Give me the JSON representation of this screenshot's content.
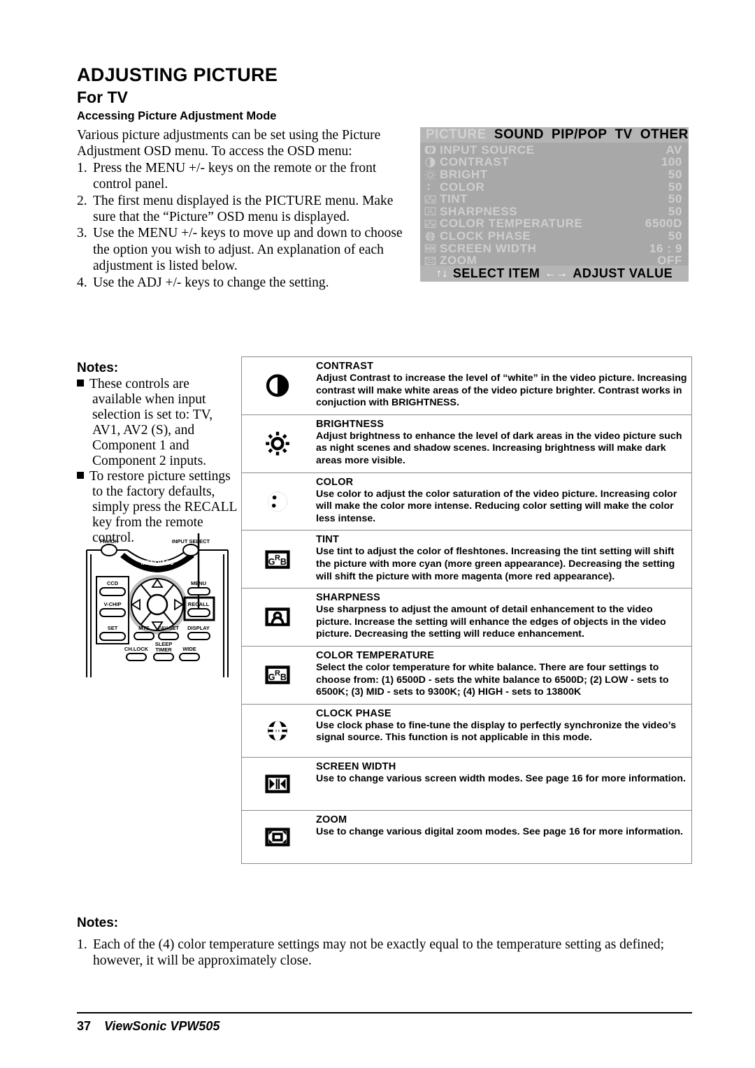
{
  "document": {
    "title_main": "ADJUSTING PICTURE",
    "title_sub": "For TV",
    "section_heading": "Accessing Picture Adjustment Mode"
  },
  "intro": {
    "paragraph": "Various picture adjustments can be set using the Picture Adjustment OSD menu.  To access the OSD menu:",
    "steps": [
      {
        "num": "1.",
        "text": "Press the MENU +/- keys on the remote or the front control panel."
      },
      {
        "num": "2.",
        "text": "The first menu displayed is the PICTURE menu.  Make sure that the “Picture” OSD menu is displayed."
      },
      {
        "num": "3.",
        "text": "Use the MENU +/- keys to move up and down to choose the option you wish to adjust.  An explanation of each adjustment is listed below."
      },
      {
        "num": "4.",
        "text": "Use the ADJ +/- keys to change the setting."
      }
    ]
  },
  "osd": {
    "tabs": [
      {
        "label": "PICTURE",
        "active": false
      },
      {
        "label": "SOUND",
        "active": true
      },
      {
        "label": "PIP/POP",
        "active": true
      },
      {
        "label": "TV",
        "active": true
      },
      {
        "label": "OTHER",
        "active": true
      }
    ],
    "rows": [
      {
        "icon": "info-icon",
        "label": "INPUT  SOURCE",
        "value": "AV"
      },
      {
        "icon": "contrast-icon",
        "label": "CONTRAST",
        "value": "100"
      },
      {
        "icon": "brightness-icon",
        "label": "BRIGHT",
        "value": "50"
      },
      {
        "icon": "color-icon",
        "label": "COLOR",
        "value": "50"
      },
      {
        "icon": "tint-grb-icon",
        "label": "TINT",
        "value": "50"
      },
      {
        "icon": "sharpness-icon",
        "label": "SHARPNESS",
        "value": "50"
      },
      {
        "icon": "color-temperature-grb-icon",
        "label": "COLOR TEMPERATURE",
        "value": "6500D"
      },
      {
        "icon": "clock-phase-icon",
        "label": "CLOCK  PHASE",
        "value": "50"
      },
      {
        "icon": "screen-width-icon",
        "label": "SCREEN  WIDTH",
        "value": "16 : 9"
      },
      {
        "icon": "zoom-icon",
        "label": "ZOOM",
        "value": "OFF"
      }
    ],
    "footer": {
      "select_label": "SELECT  ITEM",
      "adjust_label": "ADJUST  VALUE",
      "up_down_glyph": "↑↓",
      "left_right_glyph": "←→"
    },
    "colors": {
      "panel_bg": "#a8a8a8",
      "bar_bg": "#b5b5b5",
      "text": "#cfcfcf",
      "tab_active_text": "#000000",
      "tab_inactive_text": "#d2d2d2"
    }
  },
  "notes_left": {
    "heading": "Notes:",
    "items": [
      "These controls are available when input selection is set to: TV, AV1, AV2 (S), and Component 1 and Component 2 inputs.",
      "To restore picture settings to the factory defaults, simply press the RECALL key from the remote control."
    ]
  },
  "remote": {
    "labels": {
      "fav_ch": "FAV.CH",
      "input_select": "INPUT SELECT",
      "menu_adj": "MENU/ADJ",
      "ccd": "CCD",
      "v_chip": "V-CHIP",
      "set": "SET",
      "mts": "MTS",
      "fav_set": "FAV.SET",
      "menu": "MENU",
      "recall": "RECALL",
      "display": "DISPLAY",
      "ch_lock": "CH.LOCK",
      "sleep": "SLEEP",
      "timer": "TIMER",
      "wide": "WIDE"
    }
  },
  "descriptions": [
    {
      "icon": "contrast-icon",
      "title": "CONTRAST",
      "text": "Adjust Contrast to increase the level of “white” in the video picture.  Increasing contrast will make white areas of the video picture brighter.  Contrast works in conjuction with BRIGHTNESS."
    },
    {
      "icon": "brightness-icon",
      "title": "BRIGHTNESS",
      "text": "Adjust brightness to enhance the level of dark areas in the video picture such as night scenes and shadow scenes.  Increasing brightness will make dark areas more visible."
    },
    {
      "icon": "color-icon",
      "title": "COLOR",
      "text": "Use color to adjust the color saturation of the video picture.  Increasing color will make the color more intense.  Reducing color setting will make the color less intense."
    },
    {
      "icon": "tint-grb-icon",
      "title": "TINT",
      "text": "Use tint to adjust the color of fleshtones.  Increasing the tint setting will shift the picture with more cyan (more green appearance).  Decreasing the setting will shift the picture with more magenta (more red appearance)."
    },
    {
      "icon": "sharpness-icon",
      "title": "SHARPNESS",
      "text": "Use sharpness to adjust the amount of detail enhancement to the video picture.  Increase the setting will enhance the edges of objects in the video picture.  Decreasing the setting will reduce enhancement."
    },
    {
      "icon": "color-temperature-grb-icon",
      "title": "COLOR TEMPERATURE",
      "text": "Select the color temperature for white balance.  There are four settings to choose from: (1) 6500D - sets the white balance to 6500D; (2) LOW - sets to 6500K; (3) MID - sets to 9300K;  (4) HIGH - sets to 13800K"
    },
    {
      "icon": "clock-phase-icon",
      "title": "CLOCK PHASE",
      "text": "Use clock phase to fine-tune the display to perfectly synchronize the video’s signal source.  This function is not applicable in this mode."
    },
    {
      "icon": "screen-width-icon",
      "title": "SCREEN WIDTH",
      "text": "Use to change various screen width modes.  See page 16 for more information."
    },
    {
      "icon": "zoom-icon",
      "title": "ZOOM",
      "text": "Use to change various digital zoom modes.  See page 16 for more information."
    }
  ],
  "notes_bottom": {
    "heading": "Notes:",
    "items": [
      {
        "num": "1.",
        "text": "Each of the (4) color temperature settings may not be exactly equal to the temperature setting as defined; however, it will be approximately close."
      }
    ]
  },
  "footer": {
    "page_number": "37",
    "brand_model": "ViewSonic  VPW505"
  }
}
